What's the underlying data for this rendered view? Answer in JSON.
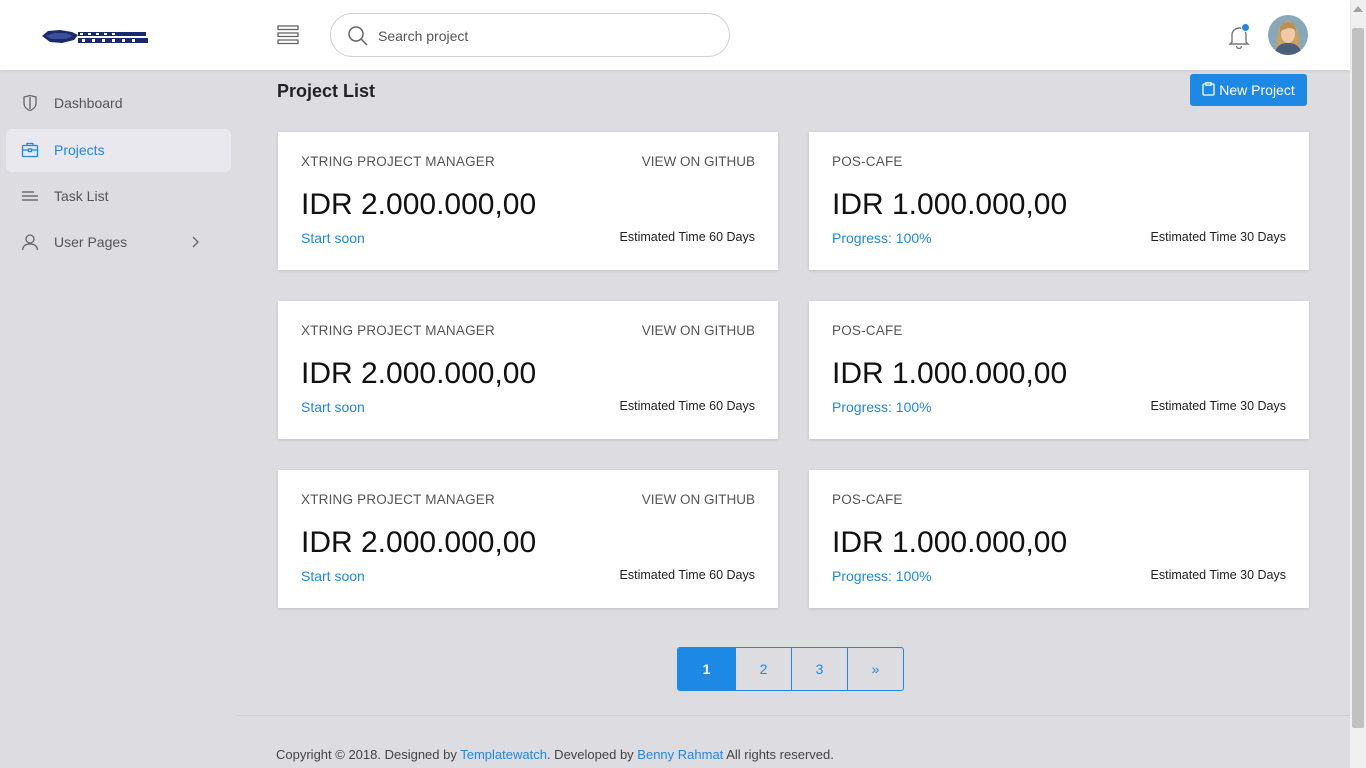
{
  "header": {
    "search_placeholder": "Search project"
  },
  "sidebar": {
    "items": [
      {
        "label": "Dashboard",
        "icon": "shield-icon"
      },
      {
        "label": "Projects",
        "icon": "briefcase-icon"
      },
      {
        "label": "Task List",
        "icon": "list-icon"
      },
      {
        "label": "User Pages",
        "icon": "user-icon"
      }
    ]
  },
  "main": {
    "title": "Project List",
    "new_project_label": "New Project",
    "cards": [
      {
        "name": "XTRING PROJECT MANAGER",
        "link": "VIEW ON GITHUB",
        "amount": "IDR 2.000.000,00",
        "status": "Start soon",
        "estimate": "Estimated Time 60 Days"
      },
      {
        "name": "POS-CAFE",
        "link": "",
        "amount": "IDR 1.000.000,00",
        "status": "Progress: 100%",
        "estimate": "Estimated Time 30 Days"
      },
      {
        "name": "XTRING PROJECT MANAGER",
        "link": "VIEW ON GITHUB",
        "amount": "IDR 2.000.000,00",
        "status": "Start soon",
        "estimate": "Estimated Time 60 Days"
      },
      {
        "name": "POS-CAFE",
        "link": "",
        "amount": "IDR 1.000.000,00",
        "status": "Progress: 100%",
        "estimate": "Estimated Time 30 Days"
      },
      {
        "name": "XTRING PROJECT MANAGER",
        "link": "VIEW ON GITHUB",
        "amount": "IDR 2.000.000,00",
        "status": "Start soon",
        "estimate": "Estimated Time 60 Days"
      },
      {
        "name": "POS-CAFE",
        "link": "",
        "amount": "IDR 1.000.000,00",
        "status": "Progress: 100%",
        "estimate": "Estimated Time 30 Days"
      }
    ]
  },
  "pagination": {
    "pages": [
      "1",
      "2",
      "3",
      "»"
    ],
    "active": "1"
  },
  "footer": {
    "prefix": "Copyright © 2018. Designed by ",
    "designer": "Templatewatch",
    "middle": ". Developed by ",
    "developer": "Benny Rahmat",
    "suffix": " All rights reserved."
  },
  "colors": {
    "accent": "#1e88e5",
    "background": "#dcdce1",
    "logo": "#1b2a6b"
  }
}
